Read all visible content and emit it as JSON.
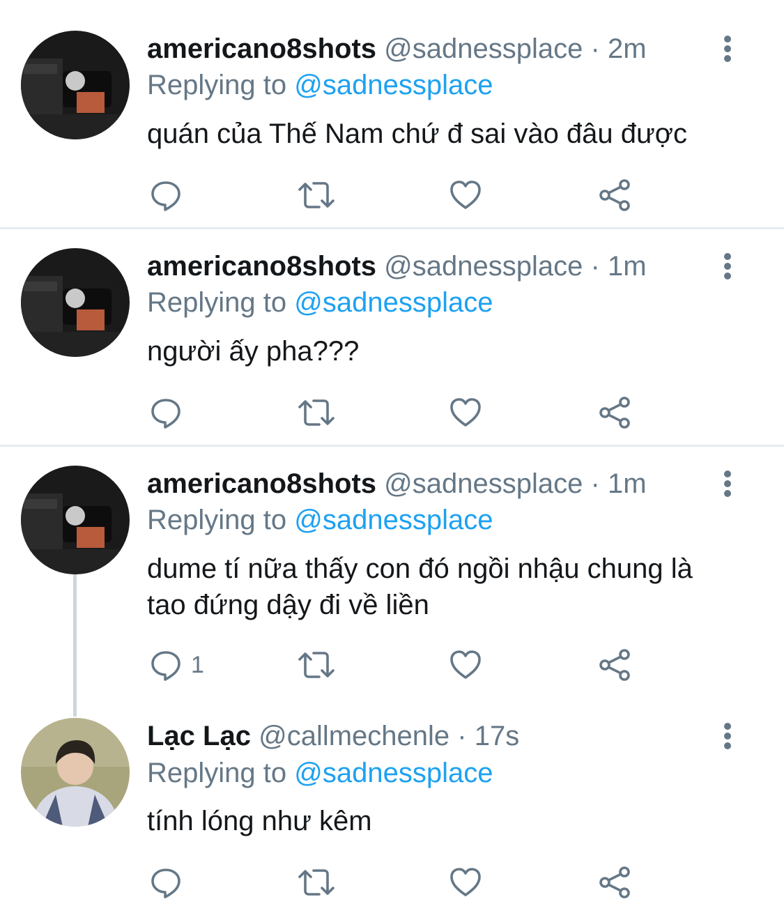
{
  "tweets": [
    {
      "name": "americano8shots",
      "handle": "@sadnessplace",
      "separator": "·",
      "time": "2m",
      "replying_prefix": "Replying to",
      "replying_handle": "@sadnessplace",
      "text": "quán của Thế Nam chứ đ sai vào đâu được",
      "reply_count": ""
    },
    {
      "name": "americano8shots",
      "handle": "@sadnessplace",
      "separator": "·",
      "time": "1m",
      "replying_prefix": "Replying to",
      "replying_handle": "@sadnessplace",
      "text": "người ấy pha???",
      "reply_count": ""
    },
    {
      "name": "americano8shots",
      "handle": "@sadnessplace",
      "separator": "·",
      "time": "1m",
      "replying_prefix": "Replying to",
      "replying_handle": "@sadnessplace",
      "text": "dume tí nữa thấy con đó ngồi nhậu chung là tao đứng dậy đi về liền",
      "reply_count": "1"
    },
    {
      "name": "Lạc Lạc",
      "handle": "@callmechenle",
      "separator": "·",
      "time": "17s",
      "replying_prefix": "Replying to",
      "replying_handle": "@sadnessplace",
      "text": "tính lóng như kêm",
      "reply_count": ""
    }
  ],
  "icons": {
    "reply": "reply-icon",
    "retweet": "retweet-icon",
    "like": "like-icon",
    "share": "share-icon",
    "more": "more-vertical-icon"
  },
  "colors": {
    "name": "#14171a",
    "secondary": "#657786",
    "link": "#1da1f2",
    "divider": "#e6ecf0"
  }
}
